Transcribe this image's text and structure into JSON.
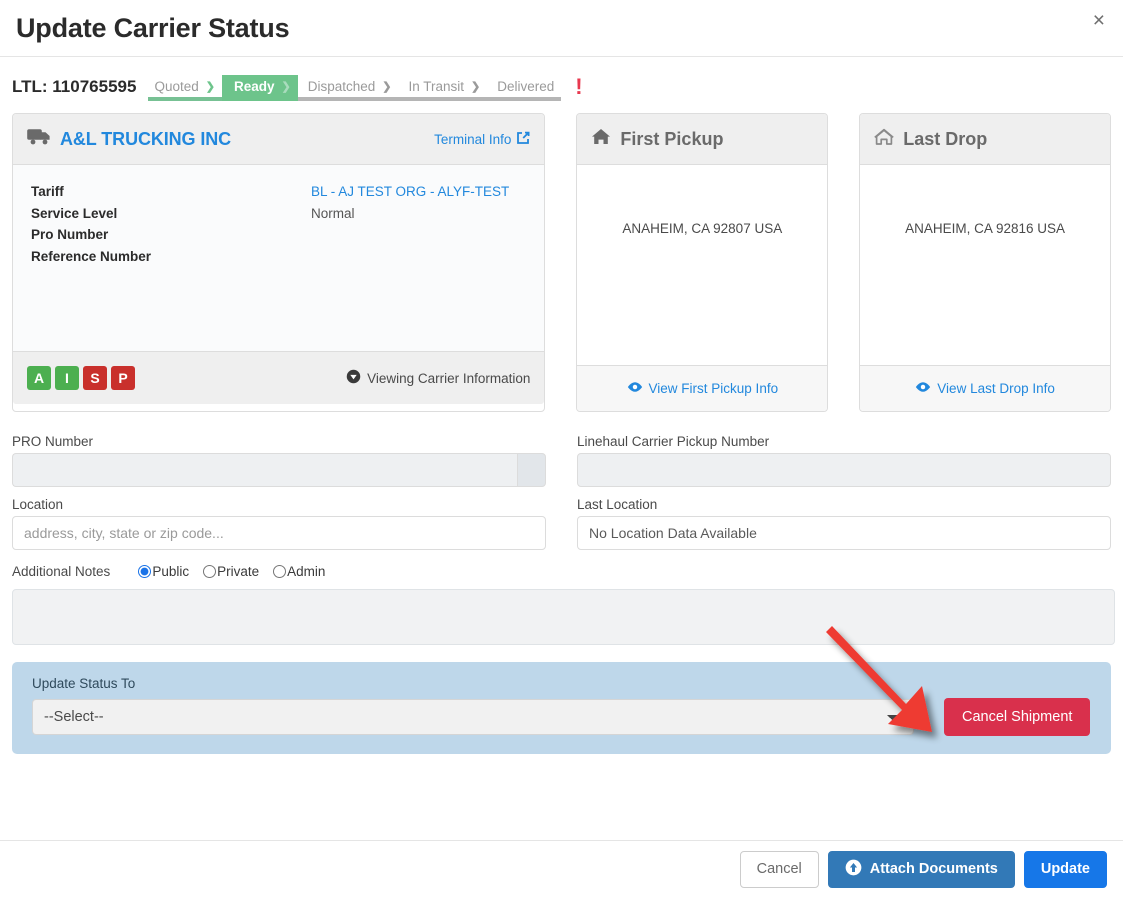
{
  "header": {
    "title": "Update Carrier Status",
    "close_label": "×"
  },
  "status_bar": {
    "shipment_label": "LTL: 110765595",
    "steps": [
      {
        "label": "Quoted",
        "state": "complete"
      },
      {
        "label": "Ready",
        "state": "active"
      },
      {
        "label": "Dispatched",
        "state": "pending"
      },
      {
        "label": "In Transit",
        "state": "pending"
      },
      {
        "label": "Delivered",
        "state": "pending"
      }
    ],
    "alert_glyph": "!"
  },
  "carrier_card": {
    "name": "A&L TRUCKING INC",
    "truck_icon": "truck-icon",
    "terminal_link": "Terminal Info",
    "rows": [
      {
        "key": "Tariff",
        "value": "BL - AJ TEST ORG - ALYF-TEST",
        "is_link": true
      },
      {
        "key": "Service Level",
        "value": "Normal",
        "is_link": false
      },
      {
        "key": "Pro Number",
        "value": "",
        "is_link": false
      },
      {
        "key": "Reference Number",
        "value": "",
        "is_link": false
      }
    ],
    "badges": [
      {
        "letter": "A",
        "color": "green"
      },
      {
        "letter": "I",
        "color": "green"
      },
      {
        "letter": "S",
        "color": "red"
      },
      {
        "letter": "P",
        "color": "red"
      }
    ],
    "footer_note": "Viewing Carrier Information"
  },
  "first_pickup": {
    "title": "First Pickup",
    "icon": "home-filled-icon",
    "address": "ANAHEIM, CA 92807 USA",
    "link": "View First Pickup Info"
  },
  "last_drop": {
    "title": "Last Drop",
    "icon": "home-outline-icon",
    "address": "ANAHEIM, CA 92816 USA",
    "link": "View Last Drop Info"
  },
  "form": {
    "pro_number": {
      "label": "PRO Number",
      "value": "",
      "placeholder": ""
    },
    "linehaul": {
      "label": "Linehaul Carrier Pickup Number",
      "value": "",
      "placeholder": ""
    },
    "location": {
      "label": "Location",
      "value": "",
      "placeholder": "address, city, state or zip code..."
    },
    "last_location": {
      "label": "Last Location",
      "value": "No Location Data Available",
      "placeholder": ""
    },
    "notes": {
      "label": "Additional Notes",
      "value": "",
      "visibility_options": [
        {
          "label": "Public",
          "selected": true
        },
        {
          "label": "Private",
          "selected": false
        },
        {
          "label": "Admin",
          "selected": false
        }
      ]
    }
  },
  "status_panel": {
    "label": "Update Status To",
    "selected": "--Select--",
    "cancel_shipment_label": "Cancel Shipment",
    "panel_color": "#bed7ea",
    "cancel_color": "#d9304c"
  },
  "footer": {
    "cancel_label": "Cancel",
    "attach_label": "Attach Documents",
    "update_label": "Update"
  },
  "annotation": {
    "type": "arrow",
    "color": "#ee3b33",
    "points_to": "Cancel Shipment button area"
  }
}
